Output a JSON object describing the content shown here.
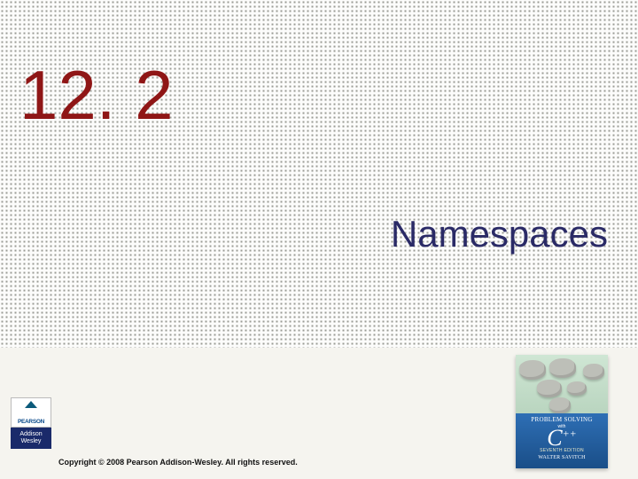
{
  "slide": {
    "section_number": "12. 2",
    "title": "Namespaces",
    "copyright": "Copyright © 2008 Pearson Addison-Wesley. All rights reserved."
  },
  "pearson_logo": {
    "brand": "PEARSON",
    "imprint_line1": "Addison",
    "imprint_line2": "Wesley"
  },
  "book_cover": {
    "title_line": "PROBLEM SOLVING",
    "with": "with",
    "lang_main": "C",
    "lang_sup": "++",
    "edition": "SEVENTH EDITION",
    "author": "WALTER SAVITCH"
  }
}
